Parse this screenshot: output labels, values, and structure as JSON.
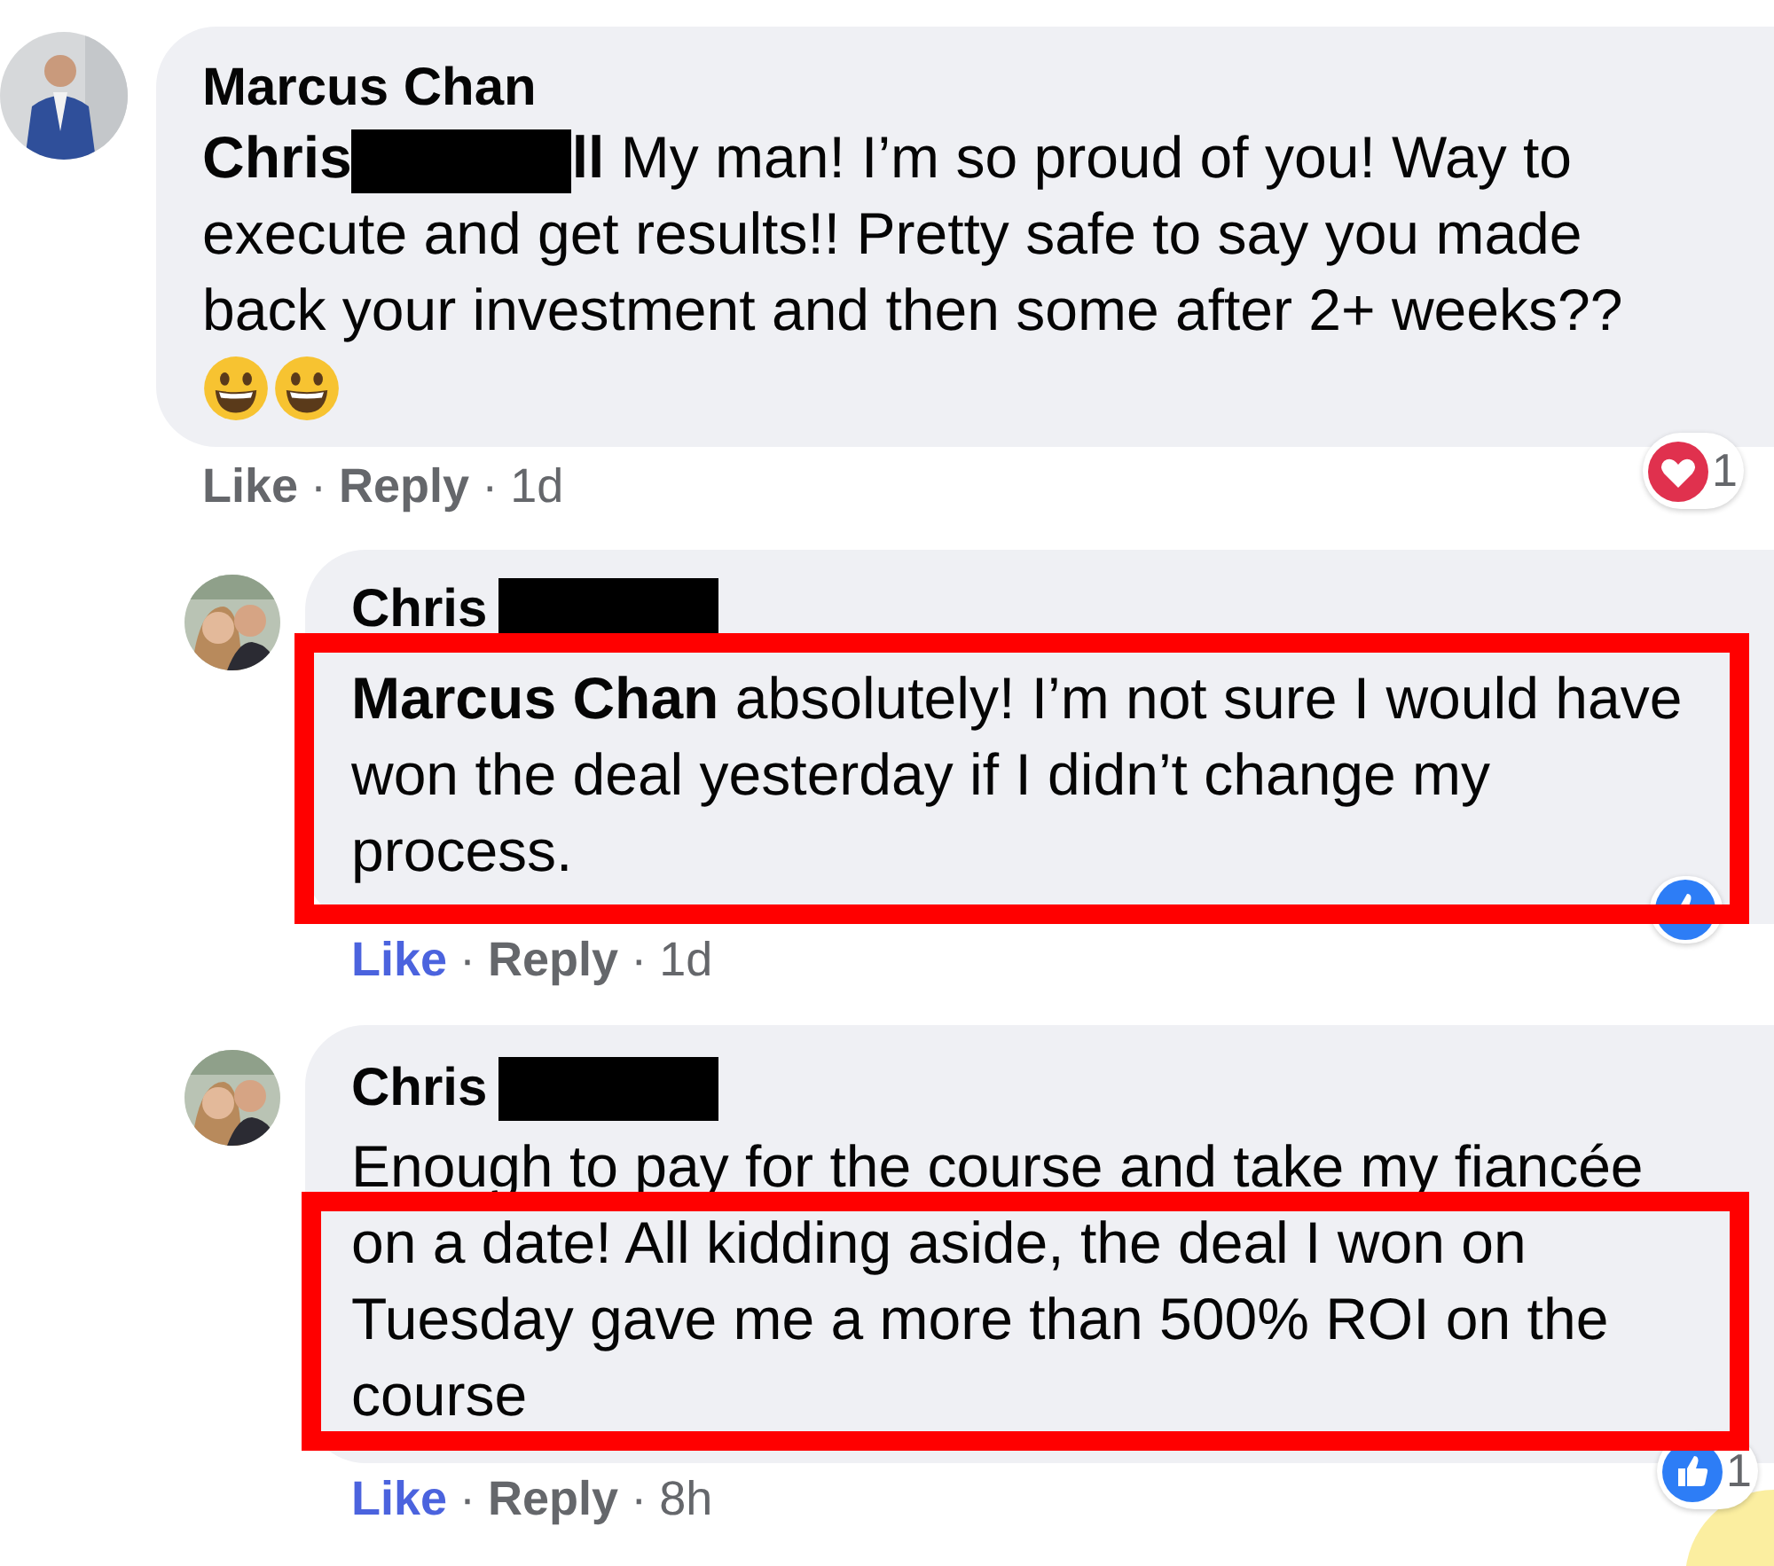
{
  "comments": [
    {
      "author": "Marcus Chan",
      "mention": "Chris",
      "mention_tail": "ll",
      "text": "My man! I’m so proud of you! Way to execute and get results!! Pretty safe to say you made back your investment and then some after 2+ weeks??",
      "actions": [
        {
          "kind": "like",
          "text": "Like",
          "liked": false
        },
        {
          "kind": "dot",
          "text": "·"
        },
        {
          "kind": "reply",
          "text": "Reply"
        },
        {
          "kind": "dot",
          "text": "·"
        },
        {
          "kind": "time",
          "text": "1d"
        }
      ],
      "reaction": {
        "kind": "heart",
        "count": "1"
      },
      "replies": [
        {
          "author": "Chris",
          "mention": "Marcus Chan",
          "text": "absolutely! I’m not sure I would have won the deal yesterday if I didn’t change my process.",
          "actions": [
            {
              "kind": "like",
              "text": "Like",
              "liked": true
            },
            {
              "kind": "dot",
              "text": "·"
            },
            {
              "kind": "reply",
              "text": "Reply"
            },
            {
              "kind": "dot",
              "text": "·"
            },
            {
              "kind": "time",
              "text": "1d"
            }
          ],
          "reaction": {
            "kind": "like"
          },
          "highlighted": true
        },
        {
          "author": "Chris",
          "text": "Enough to pay for the course and take my fiancée on a date! All kidding aside, the deal I won on Tuesday gave me a more than 500% ROI on the course",
          "actions": [
            {
              "kind": "like",
              "text": "Like",
              "liked": true
            },
            {
              "kind": "dot",
              "text": "·"
            },
            {
              "kind": "reply",
              "text": "Reply"
            },
            {
              "kind": "dot",
              "text": "·"
            },
            {
              "kind": "time",
              "text": "8h"
            }
          ],
          "reaction": {
            "kind": "like",
            "count": "1"
          },
          "highlighted": true
        }
      ]
    }
  ]
}
